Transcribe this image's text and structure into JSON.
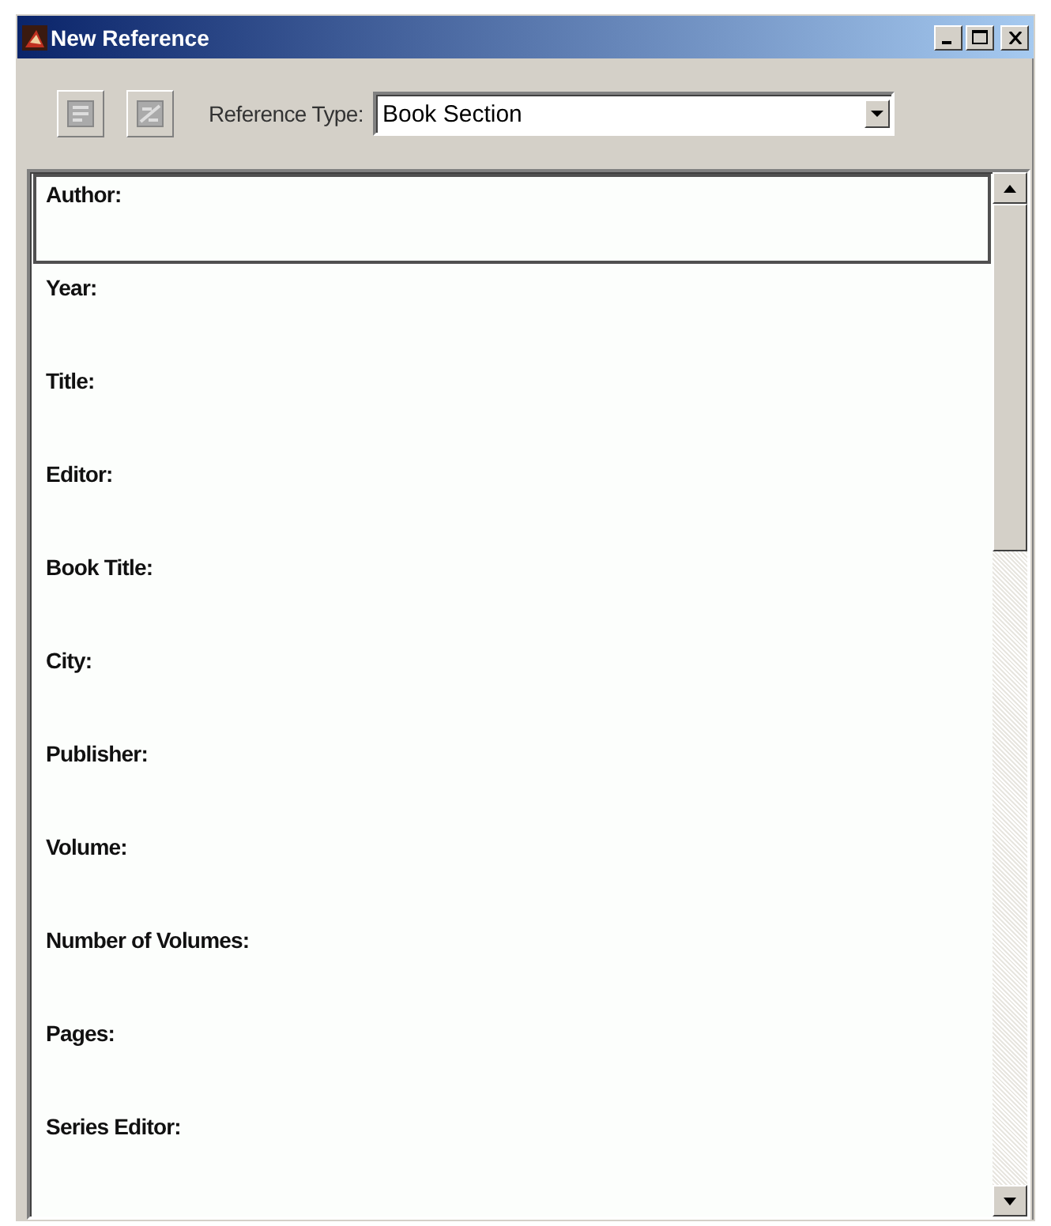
{
  "window": {
    "title": "New Reference"
  },
  "toolbar": {
    "reference_type_label": "Reference Type:",
    "reference_type": "Book Section"
  },
  "fields": [
    {
      "label": "Author:",
      "selected": true
    },
    {
      "label": "Year:",
      "selected": false
    },
    {
      "label": "Title:",
      "selected": false
    },
    {
      "label": "Editor:",
      "selected": false
    },
    {
      "label": "Book Title:",
      "selected": false
    },
    {
      "label": "City:",
      "selected": false
    },
    {
      "label": "Publisher:",
      "selected": false
    },
    {
      "label": "Volume:",
      "selected": false
    },
    {
      "label": "Number of Volumes:",
      "selected": false
    },
    {
      "label": "Pages:",
      "selected": false
    },
    {
      "label": "Series Editor:",
      "selected": false
    }
  ]
}
